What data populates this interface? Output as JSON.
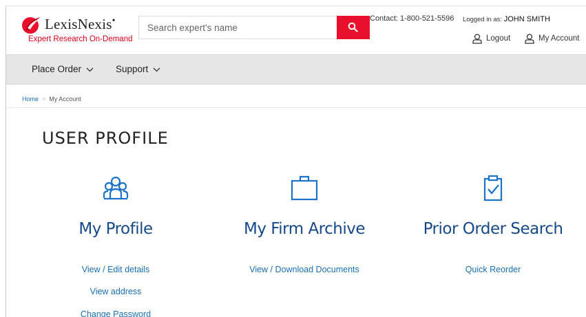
{
  "brand": {
    "name": "LexisNexis",
    "mark": "•",
    "tagline": "Expert Research On-Demand",
    "accent": "#e8102b"
  },
  "search": {
    "placeholder": "Search expert's name",
    "icon": "search-icon"
  },
  "header": {
    "contact": "Contact: 1-800-521-5596",
    "logged_in_label": "Logged in as:",
    "user_name": "JOHN SMITH",
    "logout_label": "Logout",
    "my_account_label": "My Account"
  },
  "nav": {
    "items": [
      {
        "label": "Place Order"
      },
      {
        "label": "Support"
      }
    ]
  },
  "breadcrumb": {
    "home": "Home",
    "current": "My Account"
  },
  "page": {
    "title": "USER PROFILE"
  },
  "sections": [
    {
      "title": "My Profile",
      "icon": "users-group-icon",
      "links": [
        "View / Edit details",
        "View address",
        "Change Password"
      ]
    },
    {
      "title": "My Firm Archive",
      "icon": "briefcase-icon",
      "links": [
        "View / Download Documents"
      ]
    },
    {
      "title": "Prior Order Search",
      "icon": "clipboard-check-icon",
      "links": [
        "Quick Reorder"
      ]
    }
  ],
  "colors": {
    "link": "#1a6fb5",
    "heading": "#17498a",
    "icon": "#1a73c8",
    "nav_bg": "#e6e6e6"
  }
}
